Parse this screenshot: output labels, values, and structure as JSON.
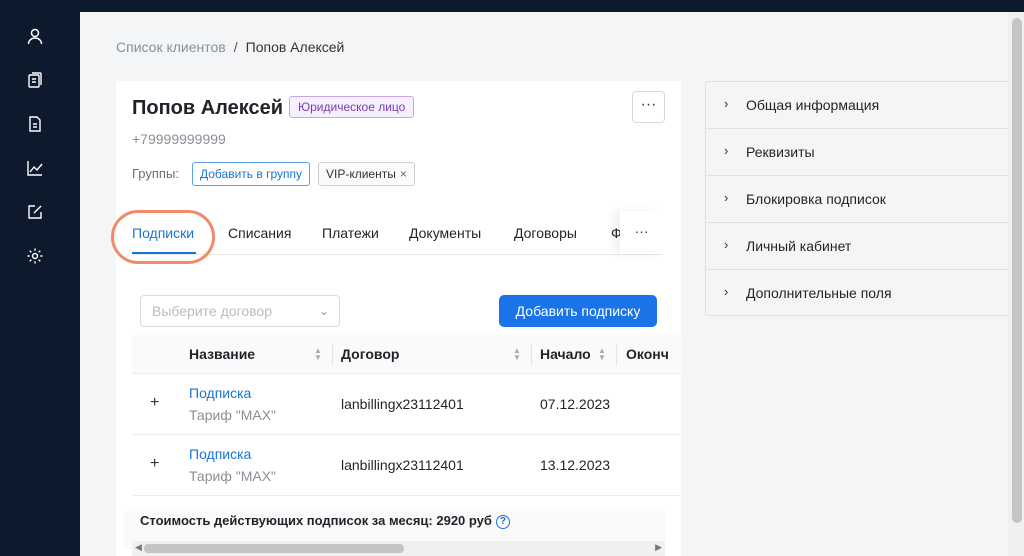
{
  "sidebar": {
    "items": [
      {
        "name": "user-icon"
      },
      {
        "name": "clipboard-icon"
      },
      {
        "name": "document-icon"
      },
      {
        "name": "chart-icon"
      },
      {
        "name": "edit-icon"
      },
      {
        "name": "gear-icon"
      }
    ]
  },
  "breadcrumb": {
    "parent": "Список клиентов",
    "separator": "/",
    "current": "Попов Алексей"
  },
  "client": {
    "name": "Попов Алексей",
    "type_badge": "Юридическое лицо",
    "phone": "+79999999999",
    "more_label": "···"
  },
  "groups": {
    "label": "Группы:",
    "add_button": "Добавить в группу",
    "tags": [
      {
        "label": "VIP-клиенты",
        "remove": "×"
      }
    ]
  },
  "tabs": {
    "items": [
      "Подписки",
      "Списания",
      "Платежи",
      "Документы",
      "Договоры",
      "Ф"
    ],
    "active": "Подписки",
    "more_label": "···"
  },
  "toolbar": {
    "contract_placeholder": "Выберите договор",
    "add_subscription": "Добавить подписку"
  },
  "table": {
    "columns": [
      "Название",
      "Договор",
      "Начало",
      "Оконч"
    ],
    "rows": [
      {
        "expand": "+",
        "title": "Подписка",
        "tariff": "Тариф \"MAX\"",
        "contract": "lanbillingx23112401",
        "start": "07.12.2023"
      },
      {
        "expand": "+",
        "title": "Подписка",
        "tariff": "Тариф \"MAX\"",
        "contract": "lanbillingx23112401",
        "start": "13.12.2023"
      }
    ],
    "footer": "Стоимость действующих подписок за месяц: 2920 руб",
    "help": "?"
  },
  "accordion": {
    "items": [
      "Общая информация",
      "Реквизиты",
      "Блокировка подписок",
      "Личный кабинет",
      "Дополнительные поля"
    ],
    "chevron": "›"
  },
  "colors": {
    "sidebar": "#0d1a2d",
    "accent": "#1b73e8",
    "highlight": "#f08a6a"
  }
}
